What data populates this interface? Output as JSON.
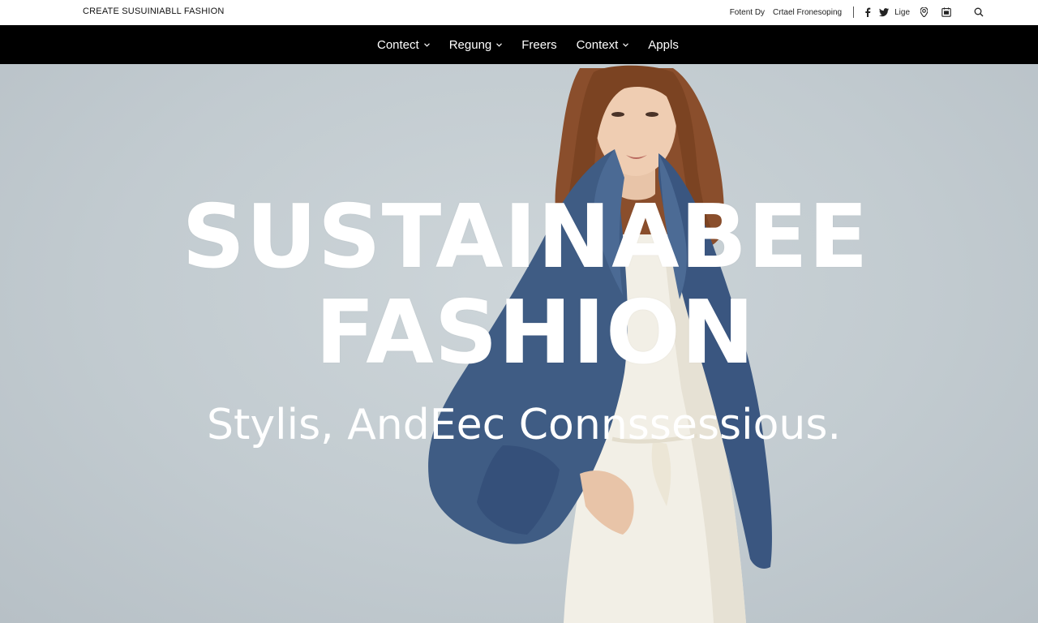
{
  "brand": "CREATE SUSUINIABLL FASHION",
  "utility": {
    "link1": "Fotent Dy",
    "link2": "Crtael Fronesoping",
    "lang": "Lige",
    "icons": [
      "facebook-icon",
      "twitter-icon",
      "location-pin-icon",
      "calendar-icon",
      "search-icon"
    ]
  },
  "nav": {
    "items": [
      {
        "label": "Contect",
        "dropdown": true
      },
      {
        "label": "Regung",
        "dropdown": true
      },
      {
        "label": "Freers",
        "dropdown": false
      },
      {
        "label": "Context",
        "dropdown": true
      },
      {
        "label": "Appls",
        "dropdown": false
      }
    ]
  },
  "hero": {
    "line1": "SUSTAINABEE",
    "line2": "FASHION",
    "tagline": "Stylis, AndEec Connssessious."
  },
  "colors": {
    "nav_bg": "#000000",
    "hero_bg": "#c6ced3",
    "jacket": "#3f5c84",
    "dress": "#f2efe6",
    "hair": "#8a4e2c"
  }
}
